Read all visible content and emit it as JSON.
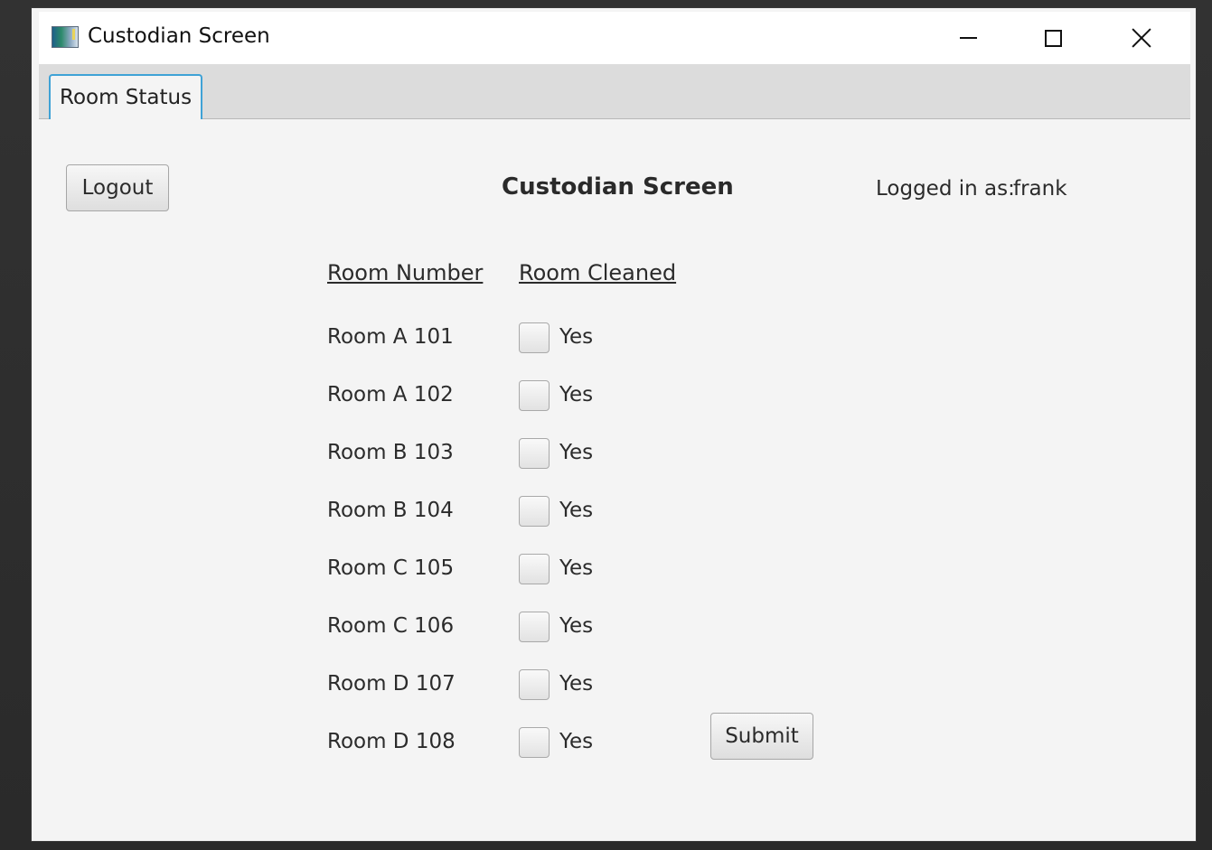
{
  "window": {
    "title": "Custodian Screen",
    "icon": "app-icon",
    "controls": {
      "minimize_icon": "minimize-icon",
      "maximize_icon": "maximize-icon",
      "close_icon": "close-icon"
    }
  },
  "tabs": [
    {
      "label": "Room Status",
      "selected": true
    }
  ],
  "toolbar": {
    "logout_label": "Logout"
  },
  "heading": "Custodian Screen",
  "login": {
    "label": "Logged in as:",
    "username": "frank"
  },
  "columns": {
    "room_number": "Room Number",
    "room_cleaned": "Room Cleaned"
  },
  "rooms": [
    {
      "name": "Room A 101",
      "cleaned_label": "Yes",
      "checked": false
    },
    {
      "name": "Room A 102",
      "cleaned_label": "Yes",
      "checked": false
    },
    {
      "name": "Room B 103",
      "cleaned_label": "Yes",
      "checked": false
    },
    {
      "name": "Room B 104",
      "cleaned_label": "Yes",
      "checked": false
    },
    {
      "name": "Room C 105",
      "cleaned_label": "Yes",
      "checked": false
    },
    {
      "name": "Room C 106",
      "cleaned_label": "Yes",
      "checked": false
    },
    {
      "name": "Room D 107",
      "cleaned_label": "Yes",
      "checked": false
    },
    {
      "name": "Room D 108",
      "cleaned_label": "Yes",
      "checked": false
    }
  ],
  "actions": {
    "submit_label": "Submit"
  },
  "colors": {
    "accent": "#3fa2d6",
    "background": "#f4f4f4",
    "tabbar": "#dcdcdc"
  }
}
